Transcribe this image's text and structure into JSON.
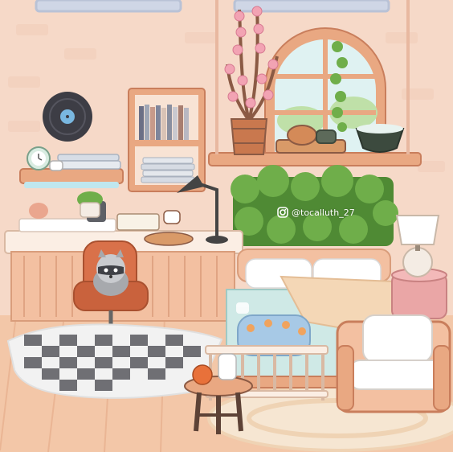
{
  "scene": {
    "watermark_handle": "@tocalluth_27",
    "objects": [
      "wall-frames",
      "vinyl-record",
      "wall-shelf",
      "alarm-clock",
      "bookcase",
      "cherry-blossom-plant",
      "round-window",
      "ivy-vine",
      "tea-set",
      "bowl",
      "hedge",
      "desk-lamp",
      "desk",
      "office-chair",
      "raccoon-plush",
      "checkered-rug",
      "bed",
      "crib",
      "table-lamp",
      "nightstand",
      "armchair",
      "side-stool",
      "round-rug"
    ]
  },
  "colors": {
    "wall": "#f6d9c8",
    "floor": "#f3c7a8",
    "wood": "#e9a882",
    "wood_dark": "#c97e5c",
    "chair": "#d9714a",
    "hedge": "#5f9a3c",
    "bed_blanket": "#cfe9e6",
    "bed_checks": "#f4d7b6"
  }
}
